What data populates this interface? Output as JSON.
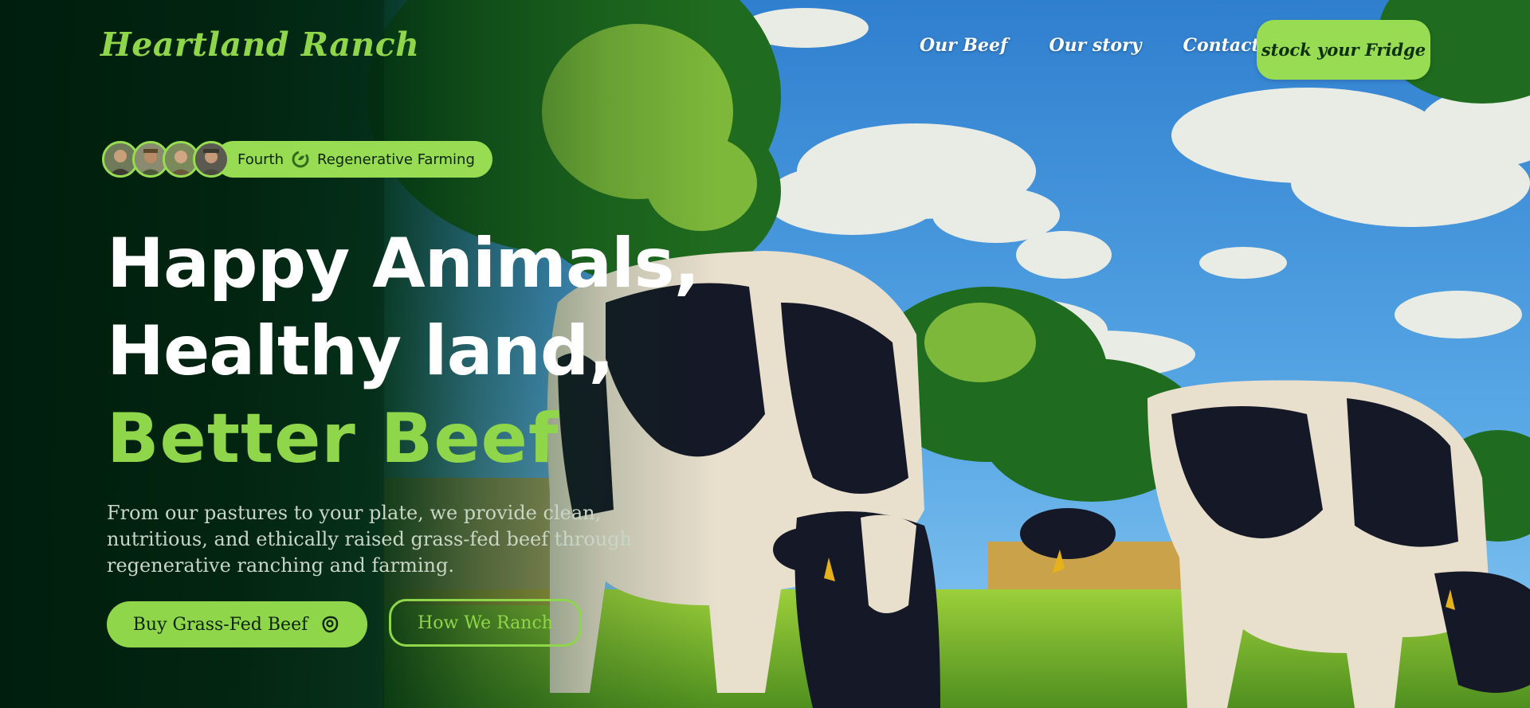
{
  "brand": {
    "name": "Heartland Ranch"
  },
  "nav": {
    "items": [
      "Our Beef",
      "Our story",
      "Contact"
    ],
    "cta": "stock your Fridge"
  },
  "badge": {
    "label_left": "Fourth",
    "label_right": "Regenerative Farming"
  },
  "hero": {
    "line1": "Happy Animals,",
    "line2": "Healthy land,",
    "line3": "Better Beef",
    "subtitle": "From our pastures to your plate, we provide clean, nutritious, and ethically raised grass-fed beef through regenerative ranching and farming.",
    "primary_button": "Buy Grass-Fed Beef",
    "secondary_button": "How We Ranch"
  },
  "colors": {
    "accent": "#8fd64a",
    "dark_bg": "#03210f",
    "sky": "#3d8fd6"
  },
  "icons": {
    "badge_icon": "leaf-recycle-icon",
    "primary_button_icon": "steak-icon"
  }
}
